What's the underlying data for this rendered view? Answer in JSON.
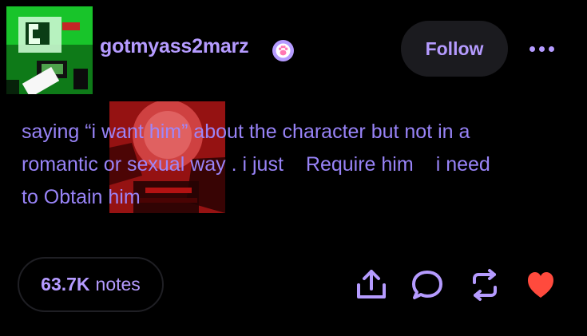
{
  "post": {
    "username": "gotmyass2marz",
    "follow_label": "Follow",
    "text_lines": [
      [
        "saying “i want him” about the character but not in a"
      ],
      [
        "romantic or sexual way . i just",
        "Require him",
        "i need"
      ],
      [
        "to Obtain him"
      ]
    ]
  },
  "footer": {
    "notes_count": "63.7K",
    "notes_label": "notes"
  },
  "icons": {
    "share": "share-icon",
    "comment": "comment-icon",
    "reblog": "reblog-icon",
    "like": "heart-icon",
    "more": "more-icon",
    "badge": "paw-badge-icon"
  },
  "colors": {
    "background": "#000000",
    "accent": "#b59bff",
    "text": "#9d88ff",
    "button_bg": "#1b1b1f",
    "like": "#ff4a3d",
    "avatar_green": "#13b81f",
    "image_red": "#b71717"
  }
}
